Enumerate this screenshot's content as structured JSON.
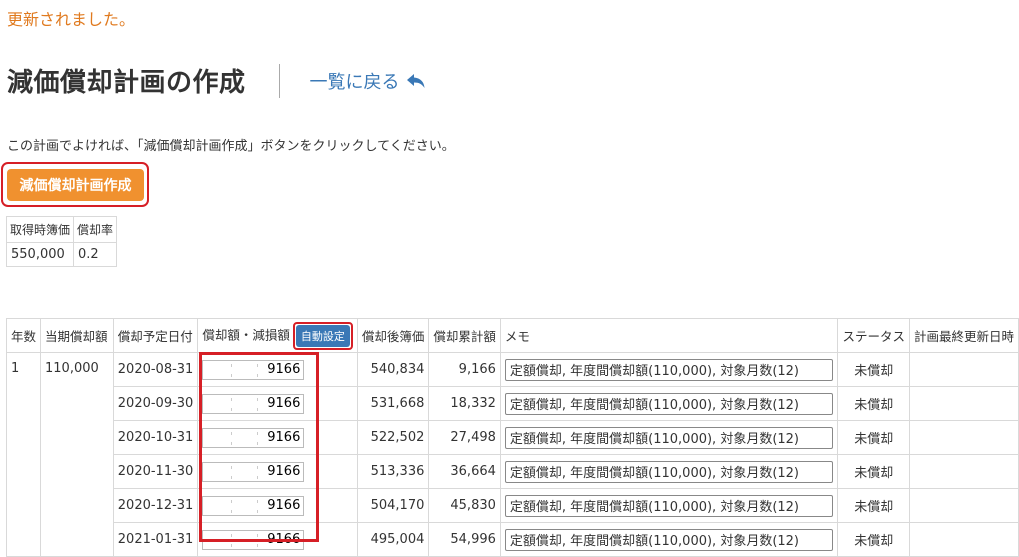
{
  "notice": "更新されました。",
  "page_title": "減価償却計画の作成",
  "back_link": "一覧に戻る",
  "instruction": "この計画でよければ、「減価償却計画作成」ボタンをクリックしてください。",
  "create_button": "減価償却計画作成",
  "summary": {
    "headers": [
      "取得時簿価",
      "償却率"
    ],
    "values": [
      "550,000",
      "0.2"
    ]
  },
  "plan": {
    "headers": {
      "year": "年数",
      "current_depreciation": "当期償却額",
      "scheduled_date": "償却予定日付",
      "amount": "償却額・減損額",
      "auto_button": "自動設定",
      "book_value": "償却後簿価",
      "accumulated": "償却累計額",
      "memo": "メモ",
      "status": "ステータス",
      "updated_at": "計画最終更新日時"
    },
    "year": "1",
    "current_depreciation": "110,000",
    "rows": [
      {
        "date": "2020-08-31",
        "amount": "9166",
        "book_value": "540,834",
        "accumulated": "9,166",
        "memo": "定額償却, 年度間償却額(110,000), 対象月数(12)",
        "status": "未償却",
        "updated_at": ""
      },
      {
        "date": "2020-09-30",
        "amount": "9166",
        "book_value": "531,668",
        "accumulated": "18,332",
        "memo": "定額償却, 年度間償却額(110,000), 対象月数(12)",
        "status": "未償却",
        "updated_at": ""
      },
      {
        "date": "2020-10-31",
        "amount": "9166",
        "book_value": "522,502",
        "accumulated": "27,498",
        "memo": "定額償却, 年度間償却額(110,000), 対象月数(12)",
        "status": "未償却",
        "updated_at": ""
      },
      {
        "date": "2020-11-30",
        "amount": "9166",
        "book_value": "513,336",
        "accumulated": "36,664",
        "memo": "定額償却, 年度間償却額(110,000), 対象月数(12)",
        "status": "未償却",
        "updated_at": ""
      },
      {
        "date": "2020-12-31",
        "amount": "9166",
        "book_value": "504,170",
        "accumulated": "45,830",
        "memo": "定額償却, 年度間償却額(110,000), 対象月数(12)",
        "status": "未償却",
        "updated_at": ""
      },
      {
        "date": "2021-01-31",
        "amount": "9166",
        "book_value": "495,004",
        "accumulated": "54,996",
        "memo": "定額償却, 年度間償却額(110,000), 対象月数(12)",
        "status": "未償却",
        "updated_at": ""
      }
    ]
  },
  "colors": {
    "notice": "#e07a1f",
    "link": "#3a78b6",
    "create_button": "#f0912f",
    "auto_button": "#3a78b6",
    "highlight": "#d61f26"
  },
  "icons": {
    "back": "reply-arrow-icon"
  }
}
